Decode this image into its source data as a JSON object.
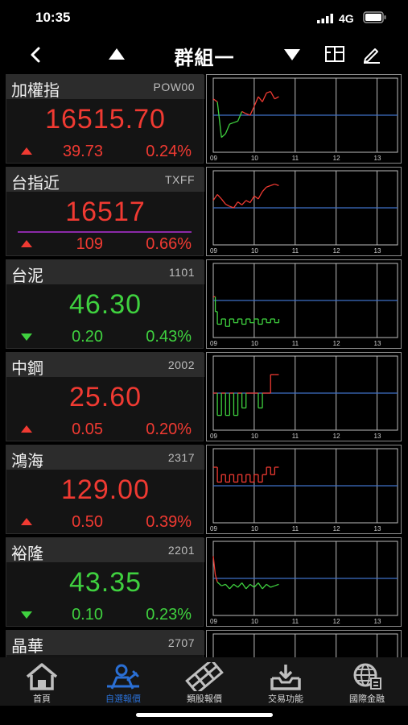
{
  "status_bar": {
    "time": "10:35",
    "network": "4G"
  },
  "nav": {
    "title": "群組一"
  },
  "chart_axis": {
    "x_ticks": [
      "09",
      "10",
      "11",
      "12",
      "13"
    ]
  },
  "quotes": [
    {
      "name": "加權指",
      "code": "POW00",
      "price": "16515.70",
      "direction": "up",
      "change": "39.73",
      "percent": "0.24%",
      "color": "#f03a32",
      "chart_data": {
        "type": "line",
        "x": [
          9.0,
          9.1,
          9.2,
          9.3,
          9.4,
          9.5,
          9.6,
          9.7,
          9.8,
          9.9,
          10.0,
          10.1,
          10.2,
          10.3,
          10.4,
          10.5,
          10.6
        ],
        "values": [
          0.72,
          0.68,
          0.2,
          0.25,
          0.38,
          0.4,
          0.42,
          0.55,
          0.52,
          0.5,
          0.62,
          0.75,
          0.68,
          0.8,
          0.82,
          0.72,
          0.75
        ],
        "reference": 0.5,
        "shade_below_reference": true
      }
    },
    {
      "name": "台指近",
      "code": "TXFF",
      "price": "16517",
      "direction": "up",
      "change": "109",
      "percent": "0.66%",
      "color": "#f03a32",
      "chart_data": {
        "type": "line",
        "x": [
          9.0,
          9.1,
          9.2,
          9.3,
          9.4,
          9.5,
          9.6,
          9.7,
          9.8,
          9.9,
          10.0,
          10.1,
          10.2,
          10.3,
          10.4,
          10.5,
          10.6
        ],
        "values": [
          0.6,
          0.68,
          0.62,
          0.55,
          0.52,
          0.5,
          0.58,
          0.54,
          0.6,
          0.57,
          0.66,
          0.62,
          0.72,
          0.78,
          0.8,
          0.82,
          0.8
        ],
        "reference": 0.5,
        "shade_below_reference": false
      }
    },
    {
      "name": "台泥",
      "code": "1101",
      "price": "46.30",
      "direction": "down",
      "change": "0.20",
      "percent": "0.43%",
      "color": "#3fd13f",
      "chart_data": {
        "type": "step",
        "x": [
          9.0,
          9.05,
          9.1,
          9.2,
          9.3,
          9.4,
          9.5,
          9.6,
          9.7,
          9.8,
          9.9,
          10.0,
          10.1,
          10.2,
          10.3,
          10.4,
          10.5,
          10.6
        ],
        "values": [
          0.55,
          0.35,
          0.18,
          0.25,
          0.15,
          0.25,
          0.2,
          0.25,
          0.18,
          0.25,
          0.2,
          0.25,
          0.18,
          0.25,
          0.2,
          0.25,
          0.2,
          0.25
        ],
        "reference": 0.5,
        "shade_below_reference": true
      }
    },
    {
      "name": "中鋼",
      "code": "2002",
      "price": "25.60",
      "direction": "up",
      "change": "0.05",
      "percent": "0.20%",
      "color": "#f03a32",
      "chart_data": {
        "type": "step",
        "x": [
          9.0,
          9.1,
          9.2,
          9.3,
          9.4,
          9.5,
          9.6,
          9.7,
          9.8,
          9.9,
          10.0,
          10.1,
          10.2,
          10.3,
          10.4,
          10.5,
          10.6
        ],
        "values": [
          0.5,
          0.2,
          0.5,
          0.2,
          0.5,
          0.2,
          0.5,
          0.3,
          0.5,
          0.5,
          0.5,
          0.3,
          0.5,
          0.5,
          0.75,
          0.75,
          0.75
        ],
        "reference": 0.5,
        "shade_below_reference": true
      }
    },
    {
      "name": "鴻海",
      "code": "2317",
      "price": "129.00",
      "direction": "up",
      "change": "0.50",
      "percent": "0.39%",
      "color": "#f03a32",
      "chart_data": {
        "type": "step",
        "x": [
          9.0,
          9.1,
          9.2,
          9.3,
          9.4,
          9.5,
          9.6,
          9.7,
          9.8,
          9.9,
          10.0,
          10.1,
          10.2,
          10.3,
          10.4,
          10.5,
          10.6
        ],
        "values": [
          0.75,
          0.55,
          0.65,
          0.55,
          0.65,
          0.55,
          0.65,
          0.55,
          0.65,
          0.55,
          0.65,
          0.55,
          0.65,
          0.75,
          0.65,
          0.75,
          0.75
        ],
        "reference": 0.5,
        "shade_below_reference": false
      }
    },
    {
      "name": "裕隆",
      "code": "2201",
      "price": "43.35",
      "direction": "down",
      "change": "0.10",
      "percent": "0.23%",
      "color": "#3fd13f",
      "chart_data": {
        "type": "line",
        "x": [
          9.0,
          9.05,
          9.1,
          9.2,
          9.3,
          9.4,
          9.5,
          9.6,
          9.7,
          9.8,
          9.9,
          10.0,
          10.1,
          10.2,
          10.3,
          10.4,
          10.5,
          10.6
        ],
        "values": [
          0.8,
          0.55,
          0.45,
          0.4,
          0.42,
          0.36,
          0.42,
          0.38,
          0.44,
          0.36,
          0.42,
          0.38,
          0.44,
          0.36,
          0.42,
          0.38,
          0.4,
          0.42
        ],
        "reference": 0.5,
        "shade_below_reference": true
      }
    },
    {
      "name": "晶華",
      "code": "2707",
      "price": "",
      "direction": "",
      "change": "",
      "percent": "",
      "color": "#f03a32",
      "chart_data": {
        "type": "line",
        "x": [],
        "values": [],
        "reference": 0.5,
        "shade_below_reference": false
      }
    }
  ],
  "tab_bar": {
    "items": [
      {
        "label": "首頁",
        "icon": "home-icon"
      },
      {
        "label": "自選報價",
        "icon": "favorites-quote-icon"
      },
      {
        "label": "類股報價",
        "icon": "sector-quote-icon"
      },
      {
        "label": "交易功能",
        "icon": "trade-icon"
      },
      {
        "label": "國際金融",
        "icon": "global-finance-icon"
      }
    ],
    "active_index": 1,
    "active_color": "#2a6fd4"
  }
}
